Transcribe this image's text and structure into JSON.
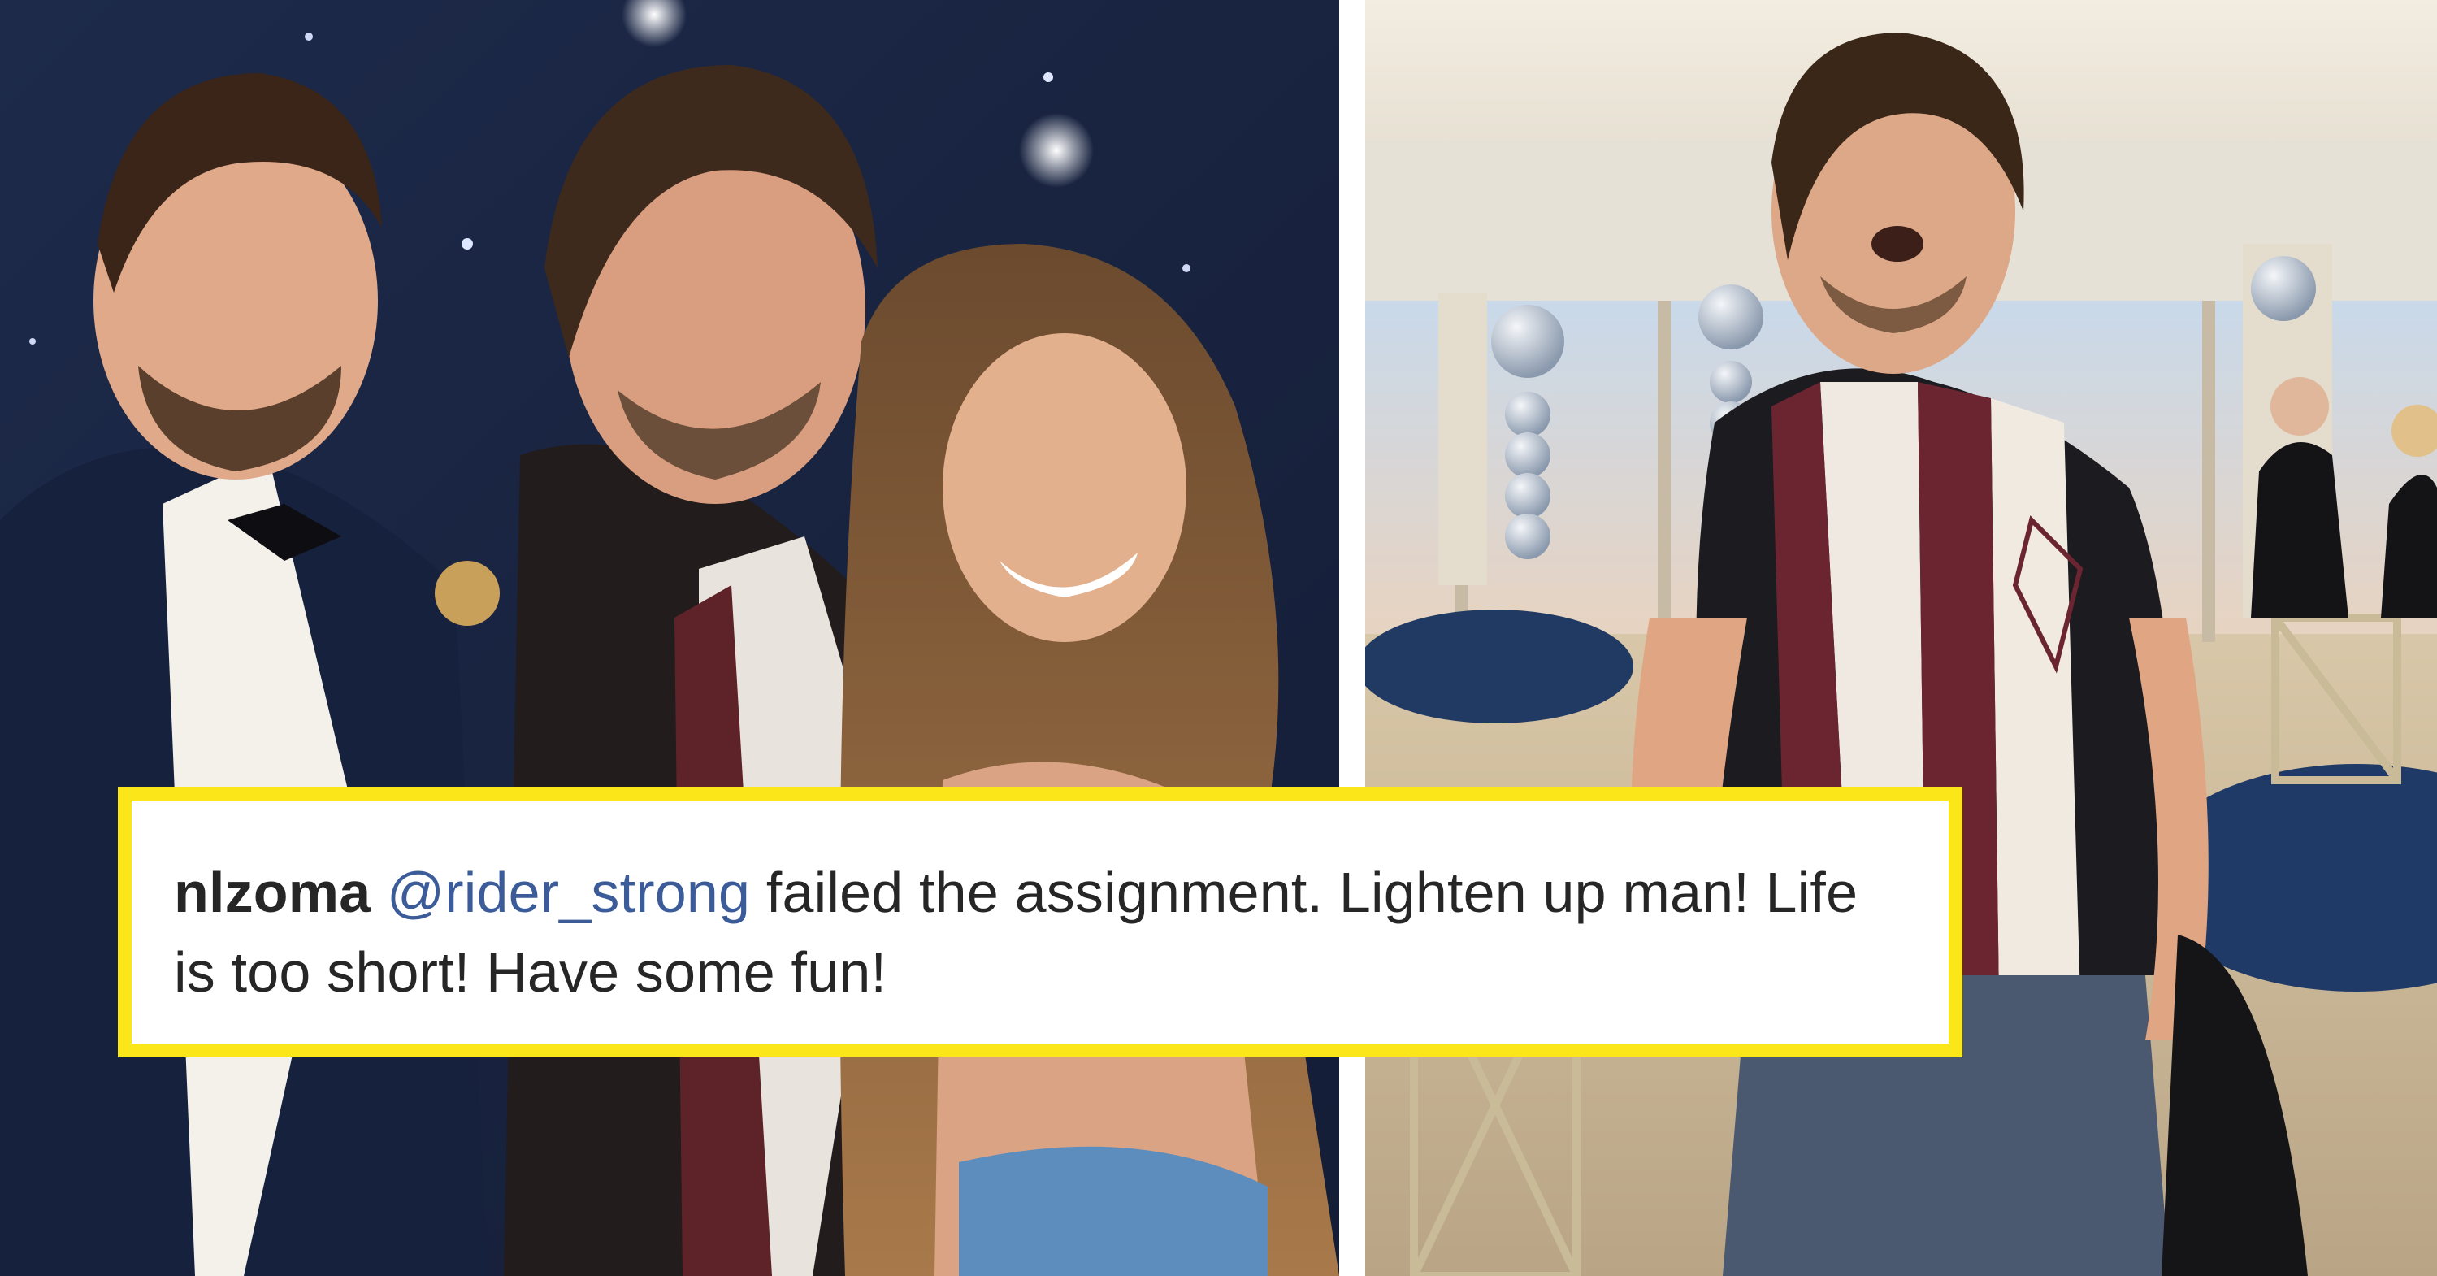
{
  "comment": {
    "username": "nlzoma",
    "mention": "@rider_strong",
    "text": "failed the assignment. Lighten up man! Life is too short! Have some fun!"
  },
  "colors": {
    "frame": "#fbe61a",
    "mention": "#3b5c99",
    "text": "#262626",
    "backdrop": "#1a2745"
  },
  "photos": {
    "left": "three-people-posing-photo",
    "right": "man-in-ballroom-photo"
  }
}
